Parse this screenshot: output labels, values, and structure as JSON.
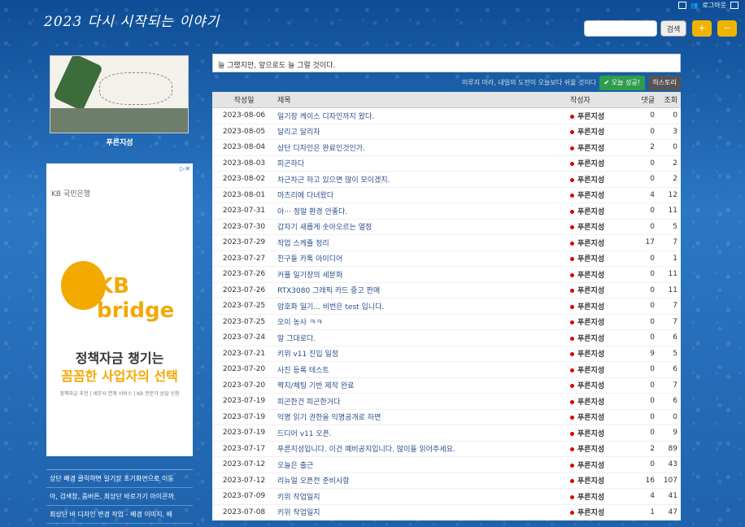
{
  "site": {
    "title": "2023 다시 시작되는 이야기"
  },
  "topbar": {
    "login": "로그아웃"
  },
  "search": {
    "value": "",
    "placeholder": "",
    "button": "검색",
    "zoom_in": "+",
    "zoom_out": "−"
  },
  "sidebar": {
    "profile_name": "푸른지성",
    "ad": {
      "brand": "KB 국민은행",
      "logo": "KB bridge",
      "line1": "정책자금 챙기는",
      "line2": "꼼꼼한 사업자의 선택",
      "foot": "정책자금 추천 | 세무사 연계 서비스 | KB 전문가 상담 신청"
    },
    "links": [
      "상단 배경 클릭하면 일기장 초기화면으로 이동",
      "아, 검색창, 줌버튼, 최상단 바로가기 아이콘까",
      "최상단 바 디자인 변경 작업 - 배경 이미지, 배"
    ]
  },
  "main": {
    "notice": "늘 그랬지만, 앞으로도 늘 그럴 것이다.",
    "quote": "미루지 마라, 내일의 도전이 오늘보다 쉬울 것이다",
    "success_button": "오늘 성공!",
    "history_button": "히스토리",
    "columns": {
      "date": "작성일",
      "title": "제목",
      "writer": "작성자",
      "comments": "댓글",
      "views": "조회"
    },
    "rows": [
      {
        "date": "2023-08-06",
        "title": "일기장 케이스 디자인까지 왔다.",
        "writer": "푸른지성",
        "comments": "0",
        "views": "0"
      },
      {
        "date": "2023-08-05",
        "title": "달리고 달리자",
        "writer": "푸른지성",
        "comments": "0",
        "views": "3"
      },
      {
        "date": "2023-08-04",
        "title": "상단 디자인은 완료인것인가.",
        "writer": "푸른지성",
        "comments": "2",
        "views": "0"
      },
      {
        "date": "2023-08-03",
        "title": "피곤하다",
        "writer": "푸른지성",
        "comments": "0",
        "views": "2"
      },
      {
        "date": "2023-08-02",
        "title": "차근차근 하고 있으면 많이 모이겠지.",
        "writer": "푸른지성",
        "comments": "0",
        "views": "2"
      },
      {
        "date": "2023-08-01",
        "title": "마츠리에 다녀왔다",
        "writer": "푸른지성",
        "comments": "4",
        "views": "12"
      },
      {
        "date": "2023-07-31",
        "title": "아··· 정말 환경 안좋다.",
        "writer": "푸른지성",
        "comments": "0",
        "views": "11"
      },
      {
        "date": "2023-07-30",
        "title": "갑자기 새롭게 솟아오르는 열정",
        "writer": "푸른지성",
        "comments": "0",
        "views": "5"
      },
      {
        "date": "2023-07-29",
        "title": "작업 스케쥴 정리",
        "writer": "푸른지성",
        "comments": "17",
        "views": "7"
      },
      {
        "date": "2023-07-27",
        "title": "친구들 카톡 아이디어",
        "writer": "푸른지성",
        "comments": "0",
        "views": "1"
      },
      {
        "date": "2023-07-26",
        "title": "커플 일기장의 세분화",
        "writer": "푸른지성",
        "comments": "0",
        "views": "11"
      },
      {
        "date": "2023-07-26",
        "title": "RTX3080 그래픽 카드 중고 판매",
        "writer": "푸른지성",
        "comments": "0",
        "views": "11"
      },
      {
        "date": "2023-07-25",
        "title": "암호화 일기... 비번은 test 입니다.",
        "writer": "푸른지성",
        "comments": "0",
        "views": "7"
      },
      {
        "date": "2023-07-25",
        "title": "오이 농사 ㅋㅋ",
        "writer": "푸른지성",
        "comments": "0",
        "views": "7"
      },
      {
        "date": "2023-07-24",
        "title": "말 그대로다.",
        "writer": "푸른지성",
        "comments": "0",
        "views": "6"
      },
      {
        "date": "2023-07-21",
        "title": "키위 v11 진입 일정",
        "writer": "푸른지성",
        "comments": "9",
        "views": "5"
      },
      {
        "date": "2023-07-20",
        "title": "사진 등록 테스트",
        "writer": "푸른지성",
        "comments": "0",
        "views": "6"
      },
      {
        "date": "2023-07-20",
        "title": "짝지/체팅 기반 제작 완료",
        "writer": "푸른지성",
        "comments": "0",
        "views": "7"
      },
      {
        "date": "2023-07-19",
        "title": "피곤한건 피곤한거다",
        "writer": "푸른지성",
        "comments": "0",
        "views": "6"
      },
      {
        "date": "2023-07-19",
        "title": "익명 읽기 권한을 익명공개로 하면",
        "writer": "푸른지성",
        "comments": "0",
        "views": "0"
      },
      {
        "date": "2023-07-19",
        "title": "드디어 v11 오픈.",
        "writer": "푸른지성",
        "comments": "0",
        "views": "9"
      },
      {
        "date": "2023-07-17",
        "title": "푸른지성입니다. 이건 예비공지입니다. 많이들 읽어주세요.",
        "writer": "푸른지성",
        "comments": "2",
        "views": "89"
      },
      {
        "date": "2023-07-12",
        "title": "오늘은 출근",
        "writer": "푸른지성",
        "comments": "0",
        "views": "43"
      },
      {
        "date": "2023-07-12",
        "title": "리뉴얼 오픈전 준비사항",
        "writer": "푸른지성",
        "comments": "16",
        "views": "107"
      },
      {
        "date": "2023-07-09",
        "title": "키위 작업일지",
        "writer": "푸른지성",
        "comments": "4",
        "views": "41"
      },
      {
        "date": "2023-07-08",
        "title": "키위 작업일지",
        "writer": "푸른지성",
        "comments": "1",
        "views": "47"
      }
    ]
  }
}
